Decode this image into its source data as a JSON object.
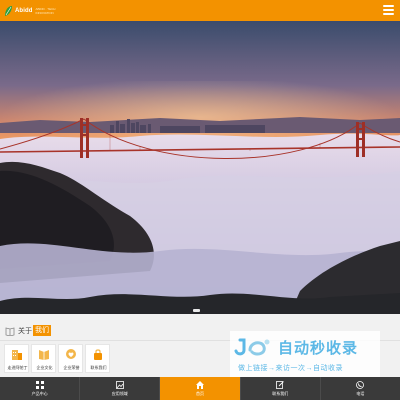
{
  "header": {
    "logo_text": "Abidd",
    "logo_sub_line1": "ABIDD · TECH",
    "logo_sub_line2": "INNOVATION",
    "menu_icon": "hamburger-menu-icon",
    "brand_color": "#f39200"
  },
  "hero": {
    "scene": "golden-gate-bridge-fog-sunset",
    "slide_count": 1,
    "active_slide": 1
  },
  "about": {
    "label_prefix": "关于",
    "label_highlight": "我们",
    "icon": "book-icon"
  },
  "quick_links": [
    {
      "label": "走进阿帕丁",
      "icon": "building-icon"
    },
    {
      "label": "企业文化",
      "icon": "book-open-icon"
    },
    {
      "label": "企业荣誉",
      "icon": "heart-badge-icon"
    },
    {
      "label": "联系我们",
      "icon": "lock-contact-icon"
    }
  ],
  "watermark": {
    "title": "自动秒收录",
    "slogan": "做上链接→来访一次→自动收录"
  },
  "bottom_nav": [
    {
      "label": "产品中心",
      "icon": "grid-icon",
      "active": false
    },
    {
      "label": "应用领域",
      "icon": "image-icon",
      "active": false
    },
    {
      "label": "首页",
      "icon": "home-icon",
      "active": true
    },
    {
      "label": "联系我们",
      "icon": "edit-icon",
      "active": false
    },
    {
      "label": "电话",
      "icon": "phone-icon",
      "active": false
    }
  ]
}
